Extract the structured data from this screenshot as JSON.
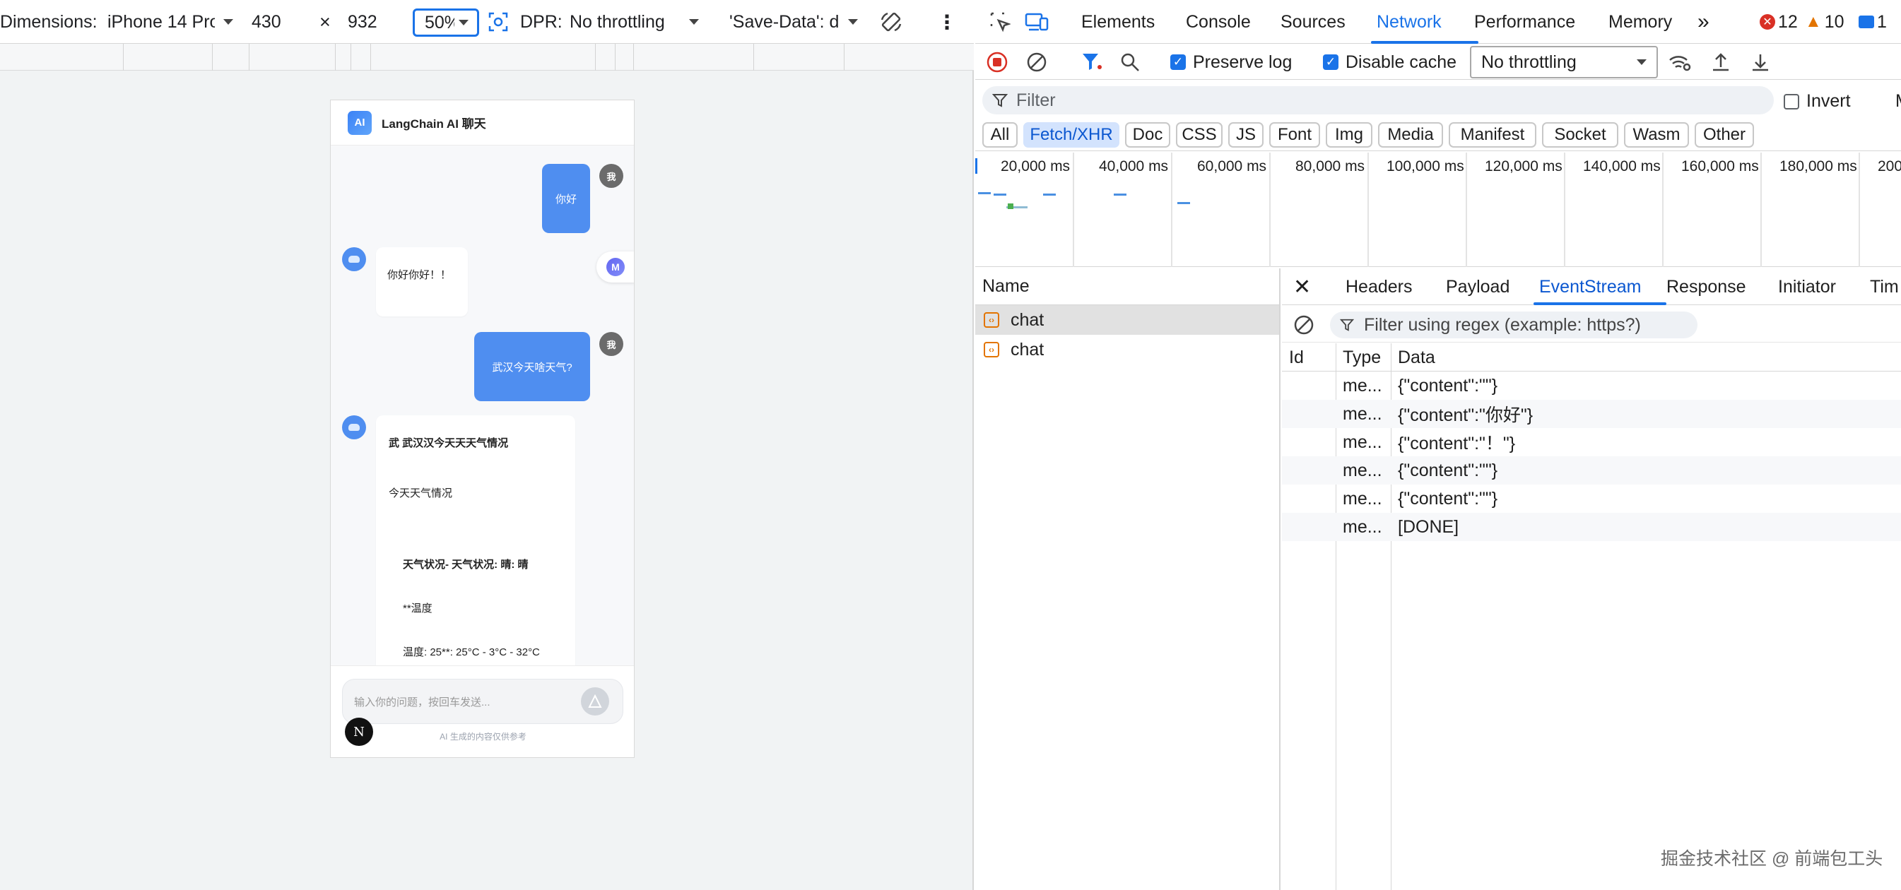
{
  "device_toolbar": {
    "dimensions_label": "Dimensions:",
    "device": "iPhone 14 Pro",
    "width": "430",
    "times": "×",
    "height": "932",
    "zoom": "50%",
    "dpr_label": "DPR:",
    "throttling": "No throttling",
    "save_data": "'Save-Data': d"
  },
  "phone": {
    "logo_text": "AI",
    "title": "LangChain AI 聊天",
    "user_avatar": "我",
    "messages": [
      {
        "role": "user",
        "text": "你好"
      },
      {
        "role": "bot",
        "text": "你好你好！！"
      },
      {
        "role": "user",
        "text": "武汉今天啥天气?"
      },
      {
        "role": "bot",
        "lines": [
          "武 武汉汉今天天天气情况",
          "今天天气情况",
          "天气状况- 天气状况: 晴: 晴",
          "**温度",
          "温度: 25**: 25°C - 3°C - 32°C"
        ]
      }
    ],
    "input_placeholder": "输入你的问题，按回车发送...",
    "footer_note": "AI 生成的内容仅供参考",
    "n_badge": "N",
    "float_icon": "M"
  },
  "devtools": {
    "tabs": [
      "Elements",
      "Console",
      "Sources",
      "Network",
      "Performance",
      "Memory"
    ],
    "active_tab": "Network",
    "more": "»",
    "errors": "12",
    "warnings": "10",
    "messages": "1",
    "network_toolbar": {
      "preserve_log": "Preserve log",
      "disable_cache": "Disable cache",
      "throttling": "No throttling"
    },
    "filter_placeholder": "Filter",
    "invert": "Invert",
    "type_filters": [
      "All",
      "Fetch/XHR",
      "Doc",
      "CSS",
      "JS",
      "Font",
      "Img",
      "Media",
      "Manifest",
      "Socket",
      "Wasm",
      "Other"
    ],
    "active_filter": "Fetch/XHR",
    "timeline_labels": [
      "20,000 ms",
      "40,000 ms",
      "60,000 ms",
      "80,000 ms",
      "100,000 ms",
      "120,000 ms",
      "140,000 ms",
      "160,000 ms",
      "180,000 ms",
      "200"
    ],
    "requests_header": "Name",
    "requests": [
      "chat",
      "chat"
    ],
    "detail_tabs": [
      "Headers",
      "Payload",
      "EventStream",
      "Response",
      "Initiator",
      "Tim"
    ],
    "active_detail_tab": "EventStream",
    "regex_placeholder": "Filter using regex (example: https?)",
    "es_columns": [
      "Id",
      "Type",
      "Data"
    ],
    "es_rows": [
      {
        "id": "",
        "type": "me...",
        "data": "{\"content\":\"\"}"
      },
      {
        "id": "",
        "type": "me...",
        "data": "{\"content\":\"你好\"}"
      },
      {
        "id": "",
        "type": "me...",
        "data": "{\"content\":\"！\"}"
      },
      {
        "id": "",
        "type": "me...",
        "data": "{\"content\":\"\"}"
      },
      {
        "id": "",
        "type": "me...",
        "data": "{\"content\":\"\"}"
      },
      {
        "id": "",
        "type": "me...",
        "data": "[DONE]"
      }
    ]
  },
  "watermark": "掘金技术社区 @ 前端包工头",
  "colors": {
    "accent": "#1a73e8",
    "bubble": "#4f8ef0",
    "error": "#d93025",
    "warning": "#e37400"
  }
}
